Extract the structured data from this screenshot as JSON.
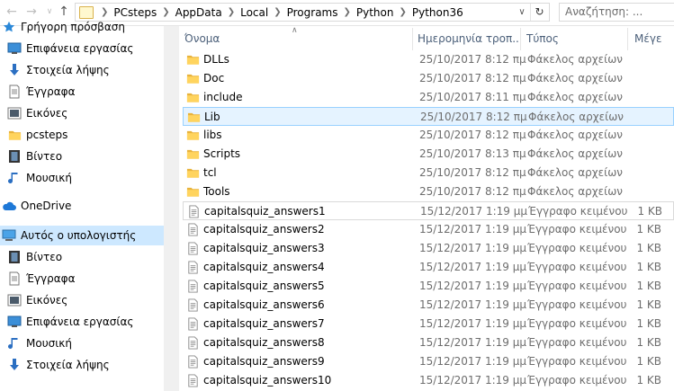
{
  "address": {
    "crumbs": [
      "PCsteps",
      "AppData",
      "Local",
      "Programs",
      "Python",
      "Python36"
    ],
    "search_placeholder": "Αναζήτηση: ..."
  },
  "nav": {
    "items": [
      {
        "label": "Γρήγορη πρόσβαση",
        "icon": "star-icon"
      },
      {
        "label": "Επιφάνεια εργασίας",
        "icon": "desktop-icon"
      },
      {
        "label": "Στοιχεία λήψης",
        "icon": "download-icon"
      },
      {
        "label": "Έγγραφα",
        "icon": "documents-icon"
      },
      {
        "label": "Εικόνες",
        "icon": "pictures-icon"
      },
      {
        "label": "pcsteps",
        "icon": "folder-icon"
      },
      {
        "label": "Βίντεο",
        "icon": "video-icon"
      },
      {
        "label": "Μουσική",
        "icon": "music-icon"
      },
      {
        "label": "OneDrive",
        "icon": "cloud-icon"
      },
      {
        "label": "Αυτός ο υπολογιστής",
        "icon": "computer-icon"
      },
      {
        "label": "Βίντεο",
        "icon": "video-icon"
      },
      {
        "label": "Έγγραφα",
        "icon": "documents-icon"
      },
      {
        "label": "Εικόνες",
        "icon": "pictures-icon"
      },
      {
        "label": "Επιφάνεια εργασίας",
        "icon": "desktop-icon"
      },
      {
        "label": "Μουσική",
        "icon": "music-icon"
      },
      {
        "label": "Στοιχεία λήψης",
        "icon": "download-icon"
      }
    ]
  },
  "columns": {
    "name": "Όνομα",
    "date": "Ημερομηνία τροπ...",
    "type": "Τύπος",
    "size": "Μέγε"
  },
  "files": [
    {
      "name": "DLLs",
      "date": "25/10/2017 8:12 πμ",
      "type": "Φάκελος αρχείων",
      "size": "",
      "kind": "folder"
    },
    {
      "name": "Doc",
      "date": "25/10/2017 8:12 πμ",
      "type": "Φάκελος αρχείων",
      "size": "",
      "kind": "folder"
    },
    {
      "name": "include",
      "date": "25/10/2017 8:11 πμ",
      "type": "Φάκελος αρχείων",
      "size": "",
      "kind": "folder"
    },
    {
      "name": "Lib",
      "date": "25/10/2017 8:12 πμ",
      "type": "Φάκελος αρχείων",
      "size": "",
      "kind": "folder"
    },
    {
      "name": "libs",
      "date": "25/10/2017 8:12 πμ",
      "type": "Φάκελος αρχείων",
      "size": "",
      "kind": "folder"
    },
    {
      "name": "Scripts",
      "date": "25/10/2017 8:13 πμ",
      "type": "Φάκελος αρχείων",
      "size": "",
      "kind": "folder"
    },
    {
      "name": "tcl",
      "date": "25/10/2017 8:12 πμ",
      "type": "Φάκελος αρχείων",
      "size": "",
      "kind": "folder"
    },
    {
      "name": "Tools",
      "date": "25/10/2017 8:12 πμ",
      "type": "Φάκελος αρχείων",
      "size": "",
      "kind": "folder"
    },
    {
      "name": "capitalsquiz_answers1",
      "date": "15/12/2017 1:19 μμ",
      "type": "Έγγραφο κειμένου",
      "size": "1 KB",
      "kind": "text"
    },
    {
      "name": "capitalsquiz_answers2",
      "date": "15/12/2017 1:19 μμ",
      "type": "Έγγραφο κειμένου",
      "size": "1 KB",
      "kind": "text"
    },
    {
      "name": "capitalsquiz_answers3",
      "date": "15/12/2017 1:19 μμ",
      "type": "Έγγραφο κειμένου",
      "size": "1 KB",
      "kind": "text"
    },
    {
      "name": "capitalsquiz_answers4",
      "date": "15/12/2017 1:19 μμ",
      "type": "Έγγραφο κειμένου",
      "size": "1 KB",
      "kind": "text"
    },
    {
      "name": "capitalsquiz_answers5",
      "date": "15/12/2017 1:19 μμ",
      "type": "Έγγραφο κειμένου",
      "size": "1 KB",
      "kind": "text"
    },
    {
      "name": "capitalsquiz_answers6",
      "date": "15/12/2017 1:19 μμ",
      "type": "Έγγραφο κειμένου",
      "size": "1 KB",
      "kind": "text"
    },
    {
      "name": "capitalsquiz_answers7",
      "date": "15/12/2017 1:19 μμ",
      "type": "Έγγραφο κειμένου",
      "size": "1 KB",
      "kind": "text"
    },
    {
      "name": "capitalsquiz_answers8",
      "date": "15/12/2017 1:19 μμ",
      "type": "Έγγραφο κειμένου",
      "size": "1 KB",
      "kind": "text"
    },
    {
      "name": "capitalsquiz_answers9",
      "date": "15/12/2017 1:19 μμ",
      "type": "Έγγραφο κειμένου",
      "size": "1 KB",
      "kind": "text"
    },
    {
      "name": "capitalsquiz_answers10",
      "date": "15/12/2017 1:19 μμ",
      "type": "Έγγραφο κειμένου",
      "size": "1 KB",
      "kind": "text"
    }
  ],
  "selected_row": "Lib",
  "focused_row": "capitalsquiz_answers1",
  "selected_nav": "Αυτός ο υπολογιστής"
}
